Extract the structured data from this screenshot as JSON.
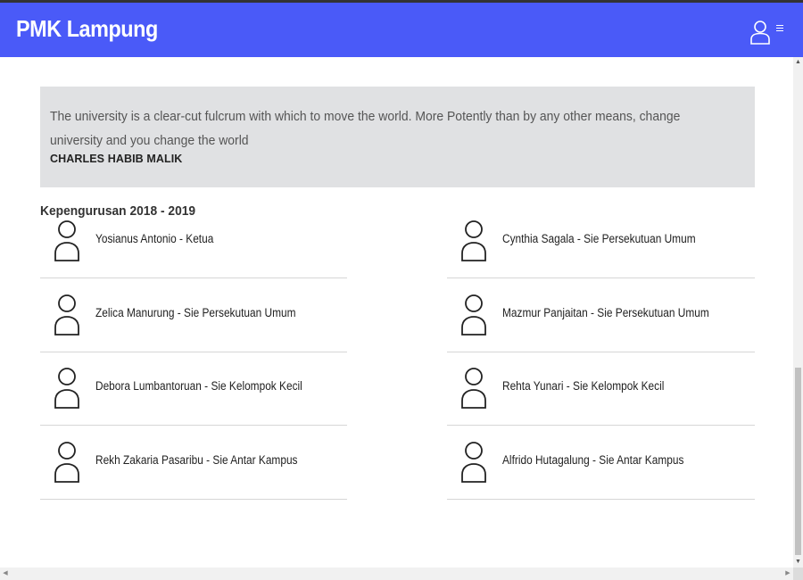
{
  "appbar": {
    "title": "PMK Lampung",
    "color": "#4a5af8"
  },
  "icons": {
    "user": "user-outline-icon",
    "menu": "hamburger-menu-icon",
    "avatar": "person-outline-icon"
  },
  "quote": {
    "text": "The university is a clear-cut fulcrum with which to move the world. More Potently than by any other means, change university and you change the world",
    "author": "CHARLES HABIB MALIK"
  },
  "period_label": "Kepengurusan 2018 - 2019",
  "members": [
    {
      "name": "Yosianus Antonio - Ketua"
    },
    {
      "name": "Cynthia Sagala - Sie Persekutuan Umum"
    },
    {
      "name": "Zelica Manurung - Sie Persekutuan Umum"
    },
    {
      "name": "Mazmur Panjaitan - Sie Persekutuan Umum"
    },
    {
      "name": "Debora Lumbantoruan - Sie Kelompok Kecil"
    },
    {
      "name": "Rehta Yunari - Sie Kelompok Kecil"
    },
    {
      "name": "Rekh Zakaria Pasaribu - Sie Antar Kampus"
    },
    {
      "name": "Alfrido Hutagalung - Sie Antar Kampus"
    }
  ]
}
